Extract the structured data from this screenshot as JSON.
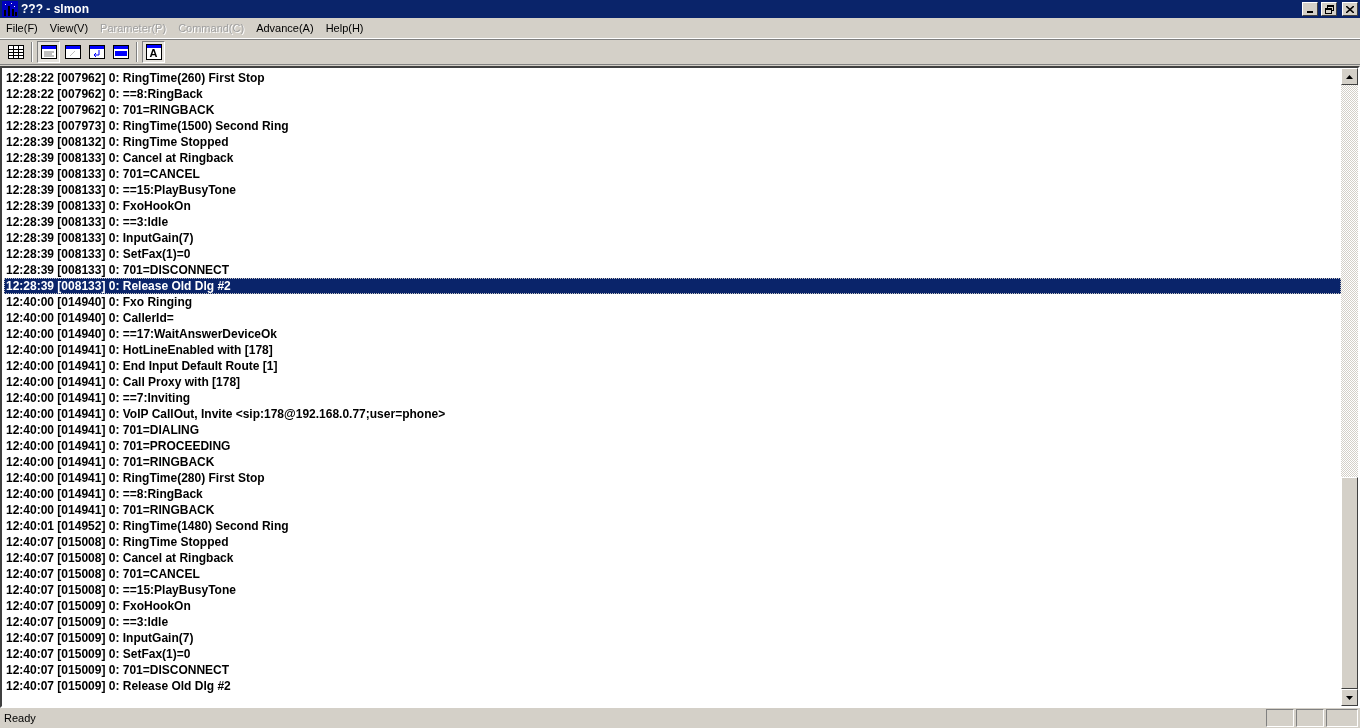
{
  "window": {
    "title": "??? - slmon"
  },
  "menu": [
    {
      "label": "File(F)",
      "disabled": false
    },
    {
      "label": "View(V)",
      "disabled": false
    },
    {
      "label": "Parameter(P)",
      "disabled": true
    },
    {
      "label": "Command(C)",
      "disabled": true
    },
    {
      "label": "Advance(A)",
      "disabled": false
    },
    {
      "label": "Help(H)",
      "disabled": false
    }
  ],
  "toolbar": [
    {
      "kind": "grid",
      "pressed": false
    },
    {
      "kind": "form",
      "pressed": true
    },
    {
      "kind": "blank",
      "pressed": false
    },
    {
      "kind": "return",
      "pressed": false
    },
    {
      "kind": "bar",
      "pressed": false
    },
    {
      "kind": "font",
      "label": "A",
      "pressed": true
    }
  ],
  "log": [
    {
      "text": "12:28:22 [007962] 0: RingTime(260) First Stop",
      "selected": false
    },
    {
      "text": "12:28:22 [007962] 0: ==8:RingBack",
      "selected": false
    },
    {
      "text": "12:28:22 [007962] 0: 701=RINGBACK",
      "selected": false
    },
    {
      "text": "12:28:23 [007973] 0: RingTime(1500) Second Ring",
      "selected": false
    },
    {
      "text": "12:28:39 [008132] 0: RingTime Stopped",
      "selected": false
    },
    {
      "text": "12:28:39 [008133] 0: Cancel at Ringback",
      "selected": false
    },
    {
      "text": "12:28:39 [008133] 0: 701=CANCEL",
      "selected": false
    },
    {
      "text": "12:28:39 [008133] 0: ==15:PlayBusyTone",
      "selected": false
    },
    {
      "text": "12:28:39 [008133] 0: FxoHookOn",
      "selected": false
    },
    {
      "text": "12:28:39 [008133] 0: ==3:Idle",
      "selected": false
    },
    {
      "text": "12:28:39 [008133] 0: InputGain(7)",
      "selected": false
    },
    {
      "text": "12:28:39 [008133] 0: SetFax(1)=0",
      "selected": false
    },
    {
      "text": "12:28:39 [008133] 0: 701=DISCONNECT",
      "selected": false
    },
    {
      "text": "12:28:39 [008133] 0: Release Old Dlg #2",
      "selected": true
    },
    {
      "text": "12:40:00 [014940] 0: Fxo Ringing",
      "selected": false
    },
    {
      "text": "12:40:00 [014940] 0: CallerId=",
      "selected": false
    },
    {
      "text": "12:40:00 [014940] 0: ==17:WaitAnswerDeviceOk",
      "selected": false
    },
    {
      "text": "12:40:00 [014941] 0: HotLineEnabled with [178]",
      "selected": false
    },
    {
      "text": "12:40:00 [014941] 0: End Input Default Route [1]",
      "selected": false
    },
    {
      "text": "12:40:00 [014941] 0: Call Proxy with [178]",
      "selected": false
    },
    {
      "text": "12:40:00 [014941] 0: ==7:Inviting",
      "selected": false
    },
    {
      "text": "12:40:00 [014941] 0: VoIP CallOut, Invite <sip:178@192.168.0.77;user=phone>",
      "selected": false
    },
    {
      "text": "12:40:00 [014941] 0: 701=DIALING",
      "selected": false
    },
    {
      "text": "12:40:00 [014941] 0: 701=PROCEEDING",
      "selected": false
    },
    {
      "text": "12:40:00 [014941] 0: 701=RINGBACK",
      "selected": false
    },
    {
      "text": "12:40:00 [014941] 0: RingTime(280) First Stop",
      "selected": false
    },
    {
      "text": "12:40:00 [014941] 0: ==8:RingBack",
      "selected": false
    },
    {
      "text": "12:40:00 [014941] 0: 701=RINGBACK",
      "selected": false
    },
    {
      "text": "12:40:01 [014952] 0: RingTime(1480) Second Ring",
      "selected": false
    },
    {
      "text": "12:40:07 [015008] 0: RingTime Stopped",
      "selected": false
    },
    {
      "text": "12:40:07 [015008] 0: Cancel at Ringback",
      "selected": false
    },
    {
      "text": "12:40:07 [015008] 0: 701=CANCEL",
      "selected": false
    },
    {
      "text": "12:40:07 [015008] 0: ==15:PlayBusyTone",
      "selected": false
    },
    {
      "text": "12:40:07 [015009] 0: FxoHookOn",
      "selected": false
    },
    {
      "text": "12:40:07 [015009] 0: ==3:Idle",
      "selected": false
    },
    {
      "text": "12:40:07 [015009] 0: InputGain(7)",
      "selected": false
    },
    {
      "text": "12:40:07 [015009] 0: SetFax(1)=0",
      "selected": false
    },
    {
      "text": "12:40:07 [015009] 0: 701=DISCONNECT",
      "selected": false
    },
    {
      "text": "12:40:07 [015009] 0: Release Old Dlg #2",
      "selected": false
    }
  ],
  "status_bar": {
    "text": "Ready"
  }
}
